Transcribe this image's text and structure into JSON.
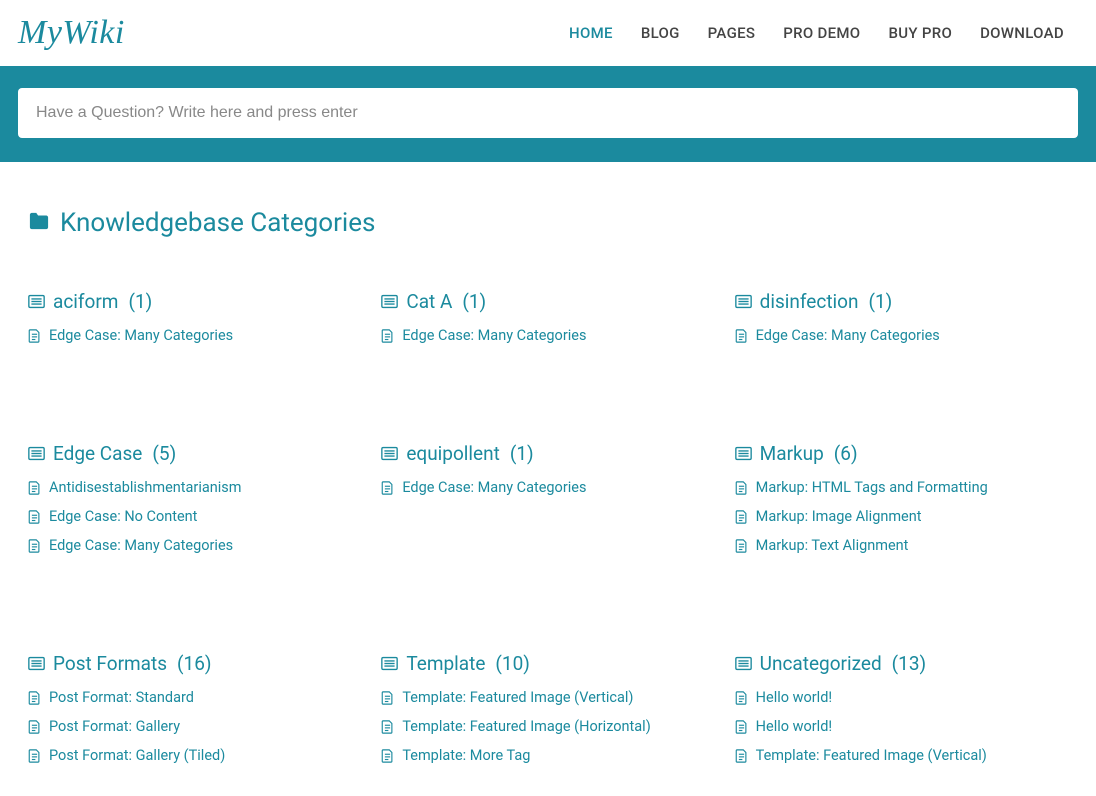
{
  "logo": "MyWiki",
  "nav": [
    {
      "label": "HOME",
      "active": true
    },
    {
      "label": "BLOG",
      "active": false
    },
    {
      "label": "PAGES",
      "active": false
    },
    {
      "label": "PRO DEMO",
      "active": false
    },
    {
      "label": "BUY PRO",
      "active": false
    },
    {
      "label": "DOWNLOAD",
      "active": false
    }
  ],
  "search": {
    "placeholder": "Have a Question? Write here and press enter"
  },
  "section_title": "Knowledgebase Categories",
  "categories": [
    {
      "name": "aciform",
      "count": "(1)",
      "items": [
        "Edge Case: Many Categories"
      ]
    },
    {
      "name": "Cat A",
      "count": "(1)",
      "items": [
        "Edge Case: Many Categories"
      ]
    },
    {
      "name": "disinfection",
      "count": "(1)",
      "items": [
        "Edge Case: Many Categories"
      ]
    },
    {
      "name": "Edge Case",
      "count": "(5)",
      "items": [
        "Antidisestablishmentarianism",
        "Edge Case: No Content",
        "Edge Case: Many Categories"
      ]
    },
    {
      "name": "equipollent",
      "count": "(1)",
      "items": [
        "Edge Case: Many Categories"
      ]
    },
    {
      "name": "Markup",
      "count": "(6)",
      "items": [
        "Markup: HTML Tags and Formatting",
        "Markup: Image Alignment",
        "Markup: Text Alignment"
      ]
    },
    {
      "name": "Post Formats",
      "count": "(16)",
      "items": [
        "Post Format: Standard",
        "Post Format: Gallery",
        "Post Format: Gallery (Tiled)"
      ]
    },
    {
      "name": "Template",
      "count": "(10)",
      "items": [
        "Template: Featured Image (Vertical)",
        "Template: Featured Image (Horizontal)",
        "Template: More Tag"
      ]
    },
    {
      "name": "Uncategorized",
      "count": "(13)",
      "items": [
        "Hello world!",
        "Hello world!",
        "Template: Featured Image (Vertical)"
      ]
    }
  ]
}
